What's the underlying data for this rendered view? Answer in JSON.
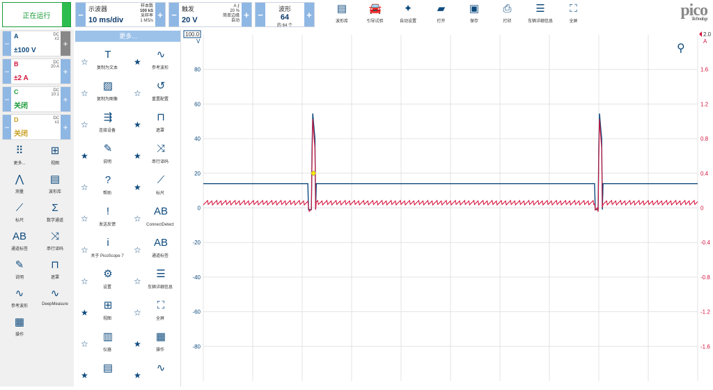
{
  "toolbar": {
    "run_label": "正在运行",
    "scope": {
      "label": "示波器",
      "value": "10 ms/div",
      "details": [
        "样本数",
        "100 kS",
        "采样率",
        "1 MS/s"
      ]
    },
    "trigger": {
      "label": "触发",
      "value": "20 V",
      "channel": "A",
      "details": [
        "20 %",
        "简单边缘",
        "自动"
      ]
    },
    "waveform": {
      "label": "波形",
      "value": "64",
      "sub": "的 64 个"
    },
    "tools": [
      {
        "label": "波形库",
        "icon": "stack-icon",
        "glyph": "▤"
      },
      {
        "label": "引导试验",
        "icon": "car-icon",
        "glyph": "🚘"
      },
      {
        "label": "自动设置",
        "icon": "wand-icon",
        "glyph": "✦"
      },
      {
        "label": "打开",
        "icon": "folder-icon",
        "glyph": "▰"
      },
      {
        "label": "保存",
        "icon": "save-icon",
        "glyph": "▣"
      },
      {
        "label": "打印",
        "icon": "print-icon",
        "glyph": "⎙"
      },
      {
        "label": "车辆详细信息",
        "icon": "clipboard-icon",
        "glyph": "☰"
      },
      {
        "label": "全屏",
        "icon": "fullscreen-icon",
        "glyph": "⛶"
      }
    ],
    "logo": "pico",
    "logo_sub": "Technology"
  },
  "channels": [
    {
      "name": "A",
      "coupling": "DC",
      "probe": "x1",
      "range": "±100 V",
      "color": "#0e4a7d"
    },
    {
      "name": "B",
      "coupling": "DC",
      "probe": "20 A",
      "range": "±2 A",
      "color": "#d4143c"
    },
    {
      "name": "C",
      "coupling": "DC",
      "probe": "10:1",
      "range": "关闭",
      "color": "#1a9a3a"
    },
    {
      "name": "D",
      "coupling": "DC",
      "probe": "x1",
      "range": "关闭",
      "color": "#c8a020"
    }
  ],
  "left_tools": [
    {
      "label": "更多...",
      "icon": "more-grid-icon",
      "glyph": "⠿"
    },
    {
      "label": "视图",
      "icon": "view-grid-icon",
      "glyph": "⊞"
    },
    {
      "label": "测量",
      "icon": "compass-icon",
      "glyph": "⋀"
    },
    {
      "label": "波形库",
      "icon": "stack-icon",
      "glyph": "▤"
    },
    {
      "label": "标尺",
      "icon": "ruler-icon",
      "glyph": "⟋"
    },
    {
      "label": "数学通道",
      "icon": "sigma-icon",
      "glyph": "Σ"
    },
    {
      "label": "通道标签",
      "icon": "abcd-icon",
      "glyph": "AB"
    },
    {
      "label": "串行译码",
      "icon": "serial-decode-icon",
      "glyph": "⤨"
    },
    {
      "label": "说明",
      "icon": "note-icon",
      "glyph": "✎"
    },
    {
      "label": "遮罩",
      "icon": "mask-icon",
      "glyph": "⊓"
    },
    {
      "label": "参考波形",
      "icon": "reference-wave-icon",
      "glyph": "∿"
    },
    {
      "label": "DeepMeasure",
      "icon": "deepmeasure-icon",
      "glyph": "∿"
    },
    {
      "label": "操作",
      "icon": "clapper-icon",
      "glyph": "▦"
    }
  ],
  "more_menu": {
    "title": "更多...",
    "items": [
      {
        "label": "复制为文本",
        "icon": "copy-text-icon",
        "glyph": "T",
        "starred": false
      },
      {
        "label": "参考波形",
        "icon": "reference-wave-icon",
        "glyph": "∿",
        "starred": true
      },
      {
        "label": "复制为图像",
        "icon": "copy-image-icon",
        "glyph": "▨",
        "starred": false
      },
      {
        "label": "重置配置",
        "icon": "reset-icon",
        "glyph": "↺",
        "starred": false
      },
      {
        "label": "连接设备",
        "icon": "usb-icon",
        "glyph": "⇶",
        "starred": false
      },
      {
        "label": "遮罩",
        "icon": "mask-icon",
        "glyph": "⊓",
        "starred": true
      },
      {
        "label": "说明",
        "icon": "note-icon",
        "glyph": "✎",
        "starred": true
      },
      {
        "label": "串行译码",
        "icon": "serial-decode-icon",
        "glyph": "⤨",
        "starred": true
      },
      {
        "label": "帮助",
        "icon": "help-icon",
        "glyph": "?",
        "starred": false
      },
      {
        "label": "标尺",
        "icon": "ruler-icon",
        "glyph": "⟋",
        "starred": true
      },
      {
        "label": "发送反馈",
        "icon": "feedback-icon",
        "glyph": "!",
        "starred": false
      },
      {
        "label": "ConnectDetect",
        "icon": "connectdetect-icon",
        "glyph": "AB",
        "starred": false
      },
      {
        "label": "关于 PicoScope 7",
        "icon": "info-icon",
        "glyph": "i",
        "starred": false
      },
      {
        "label": "通道标签",
        "icon": "abcd-icon",
        "glyph": "AB",
        "starred": false
      },
      {
        "label": "设置",
        "icon": "gear-icon",
        "glyph": "⚙",
        "starred": false
      },
      {
        "label": "车辆详细信息",
        "icon": "clipboard-icon",
        "glyph": "☰",
        "starred": false
      },
      {
        "label": "视图",
        "icon": "view-grid-icon",
        "glyph": "⊞",
        "starred": true
      },
      {
        "label": "全屏",
        "icon": "fullscreen-icon",
        "glyph": "⛶",
        "starred": false
      },
      {
        "label": "仪器",
        "icon": "instrument-icon",
        "glyph": "▥",
        "starred": false
      },
      {
        "label": "操作",
        "icon": "clapper-icon",
        "glyph": "▦",
        "starred": true
      },
      {
        "label": "",
        "icon": "stack-icon",
        "glyph": "▤",
        "starred": true
      },
      {
        "label": "",
        "icon": "deepmeasure-icon",
        "glyph": "∿",
        "starred": true
      }
    ]
  },
  "chart_data": {
    "type": "line",
    "x_divisions": 10,
    "left_axis": {
      "label": "V",
      "top_marker": "100.0",
      "ticks": [
        80.0,
        60.0,
        40.0,
        20.0,
        0.0,
        -20.0,
        -40.0,
        -60.0,
        -80.0
      ],
      "ylim": [
        -100,
        100
      ],
      "color": "#0e4a7d"
    },
    "right_axis": {
      "label": "A",
      "top_marker": "2.0",
      "ticks": [
        1.6,
        1.2,
        0.8,
        0.4,
        0.0,
        -0.4,
        -0.8,
        -1.2,
        -1.6
      ],
      "ylim": [
        -2,
        2
      ],
      "color": "#d4143c"
    },
    "series": [
      {
        "channel": "A",
        "baseline": 14,
        "pulse_peak": 56,
        "pulse_low": -1,
        "color": "#0e4a7d"
      },
      {
        "channel": "B",
        "baseline": 0.06,
        "pulse_peak": 1.06,
        "pulse_low": -0.02,
        "color": "#d4143c"
      }
    ],
    "pulse_positions": [
      0.22,
      0.8
    ],
    "trigger_marker": {
      "level": 20,
      "color": "#f2e600"
    }
  }
}
